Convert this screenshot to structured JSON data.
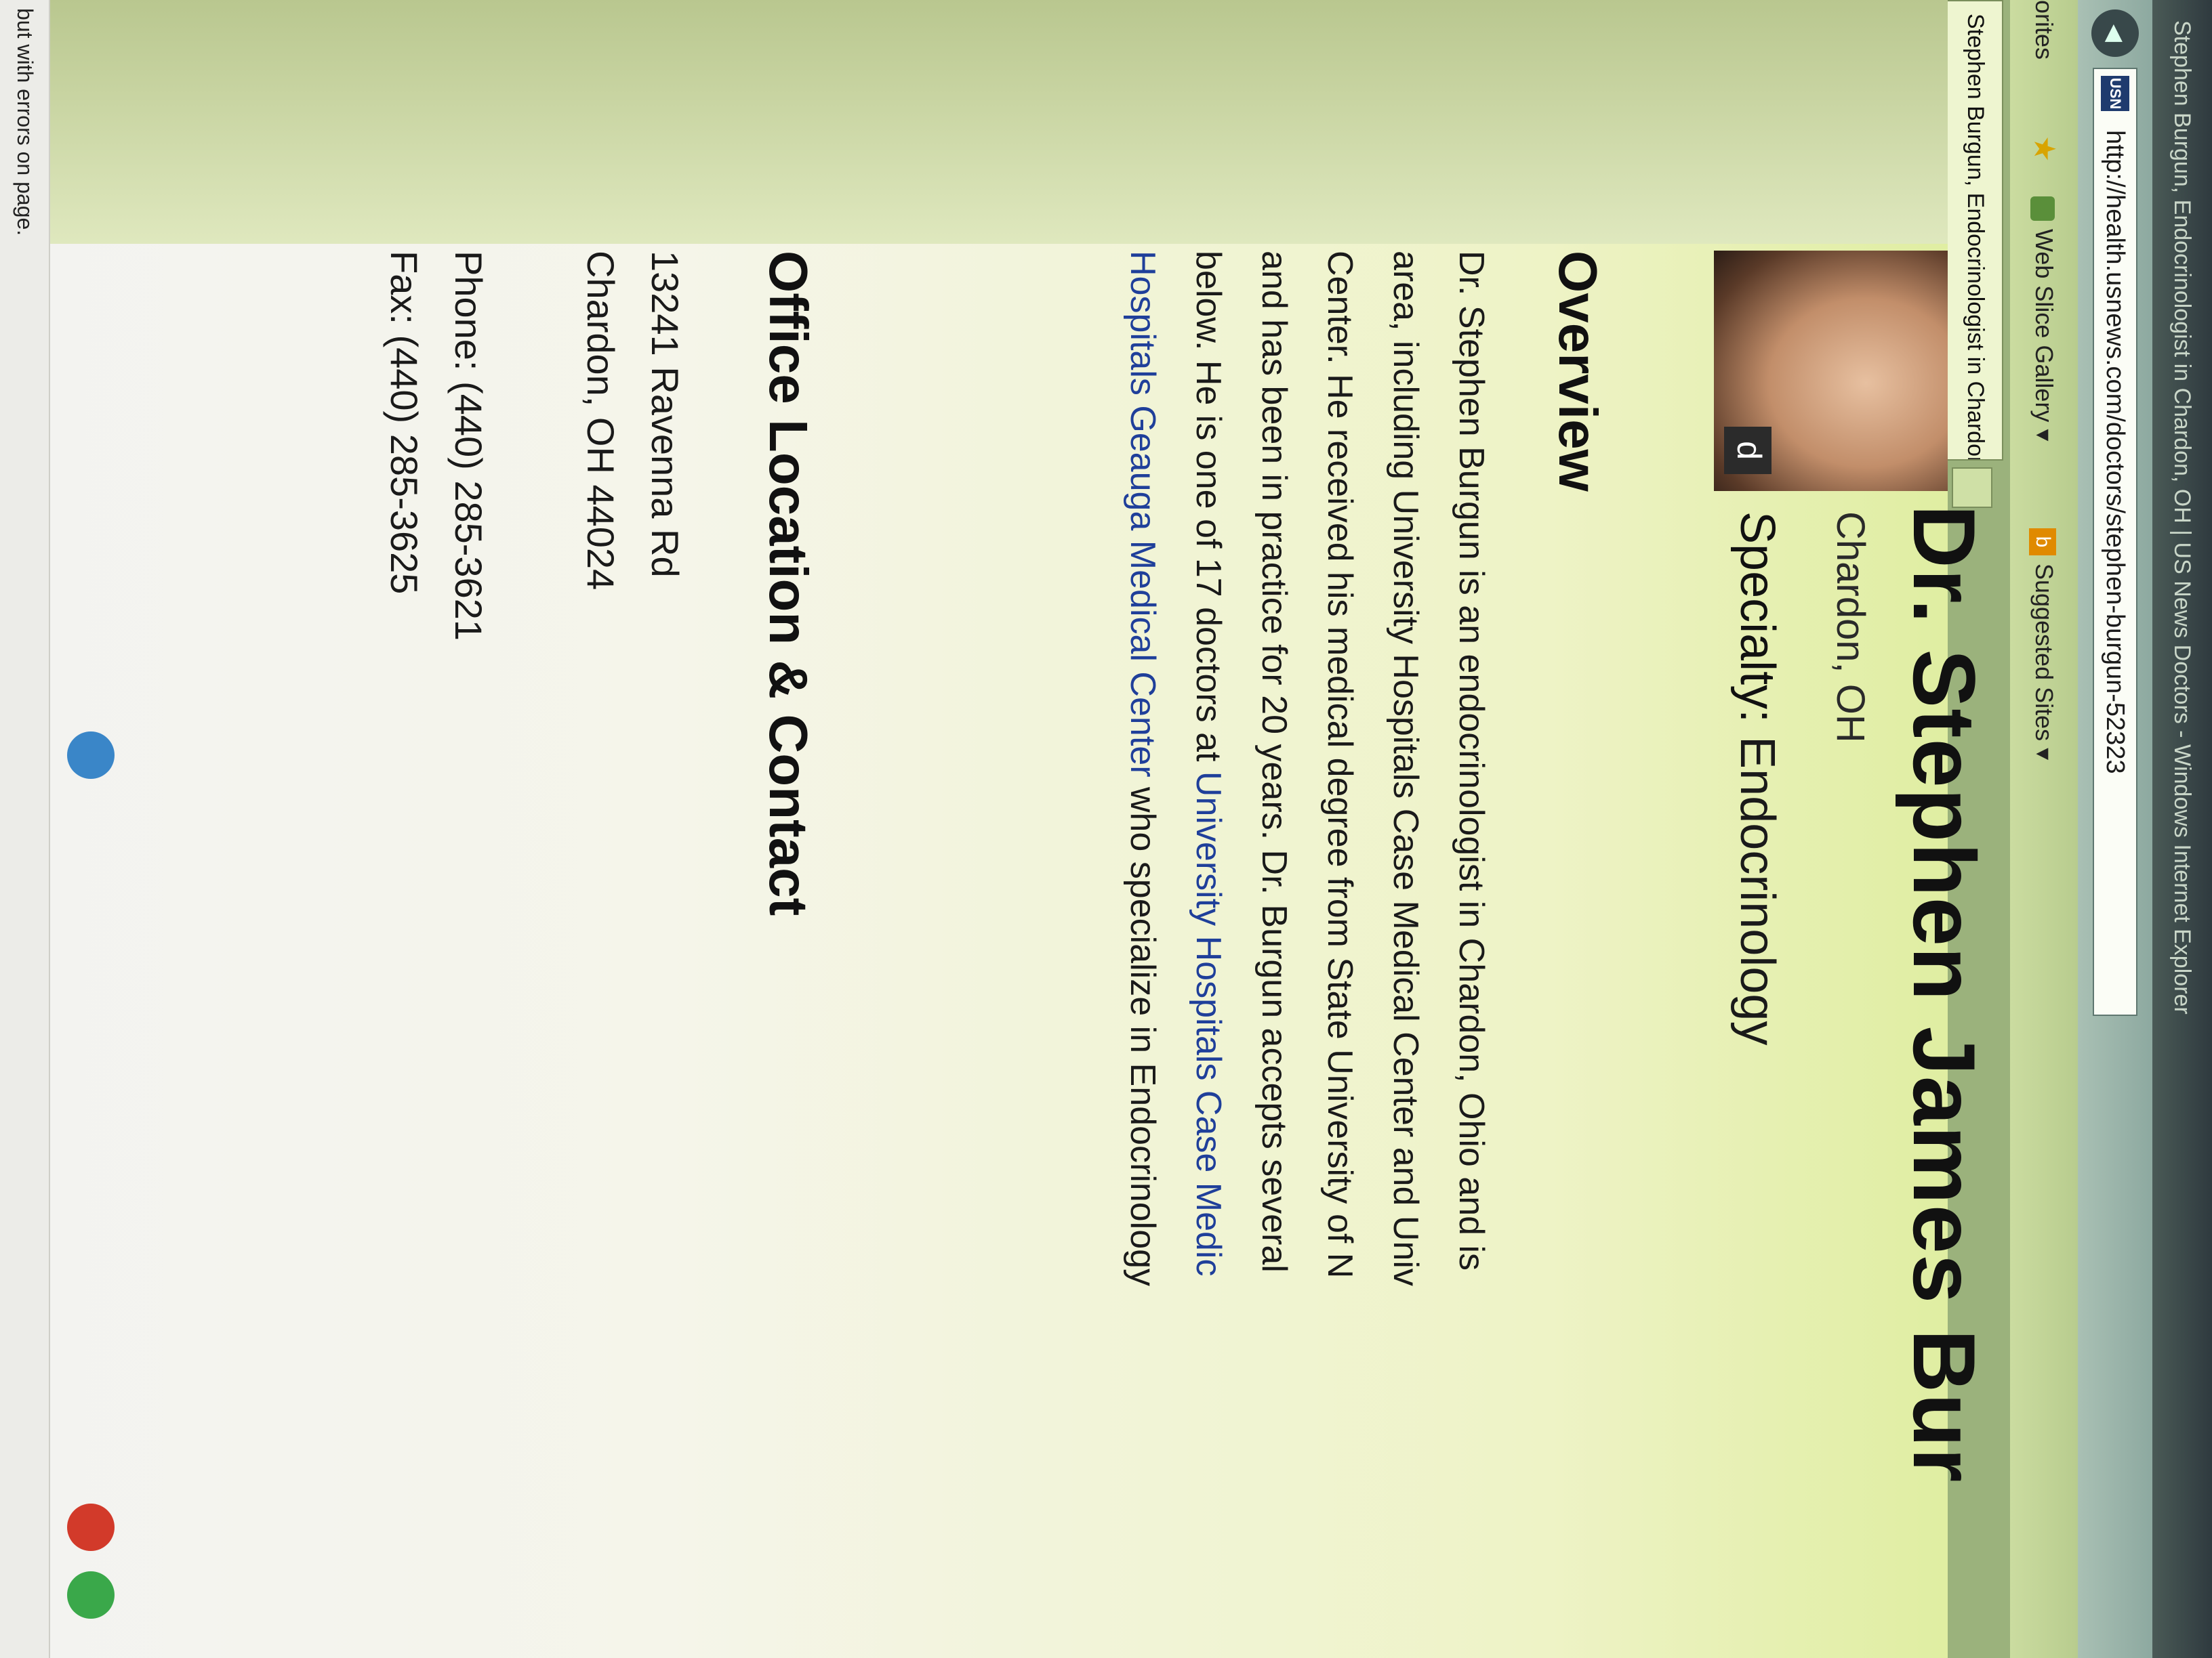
{
  "browser": {
    "window_title": "Stephen Burgun, Endocrinologist in Chardon, OH | US News Doctors - Windows Internet Explorer",
    "address": "http://health.usnews.com/doctors/stephen-burgun-52323",
    "address_favicon": "USN",
    "favorites_label": "orites",
    "web_slice_gallery": "Web Slice Gallery ▾",
    "suggested_sites": "Suggested Sites ▾",
    "tab_title": "Stephen Burgun, Endocrinologist in Chardon, ...",
    "status_text": "but with errors on page."
  },
  "profile": {
    "name": "Dr. Stephen James Bur",
    "location": "Chardon, OH",
    "specialty_label": "Specialty:",
    "specialty_value": " Endocrinology",
    "photo_badge": "d"
  },
  "overview": {
    "heading": "Overview",
    "line1": "Dr. Stephen Burgun is an endocrinologist in Chardon, Ohio and is",
    "line2": "area, including University Hospitals Case Medical Center and Univ",
    "line3": "Center. He received his medical degree from State University of N",
    "line4": "and has been in practice for 20 years. Dr. Burgun accepts several",
    "line5_pre": "below. He is one of 17 doctors at ",
    "line5_link": "University Hospitals Case Medic",
    "line6_link": "Hospitals Geauga Medical Center",
    "line6_post": " who specialize in Endocrinology"
  },
  "office": {
    "heading": "Office Location & Contact",
    "street": "13241 Ravenna Rd",
    "city_state_zip": "Chardon, OH 44024",
    "phone": "Phone: (440) 285-3621",
    "fax": "Fax: (440) 285-3625"
  }
}
